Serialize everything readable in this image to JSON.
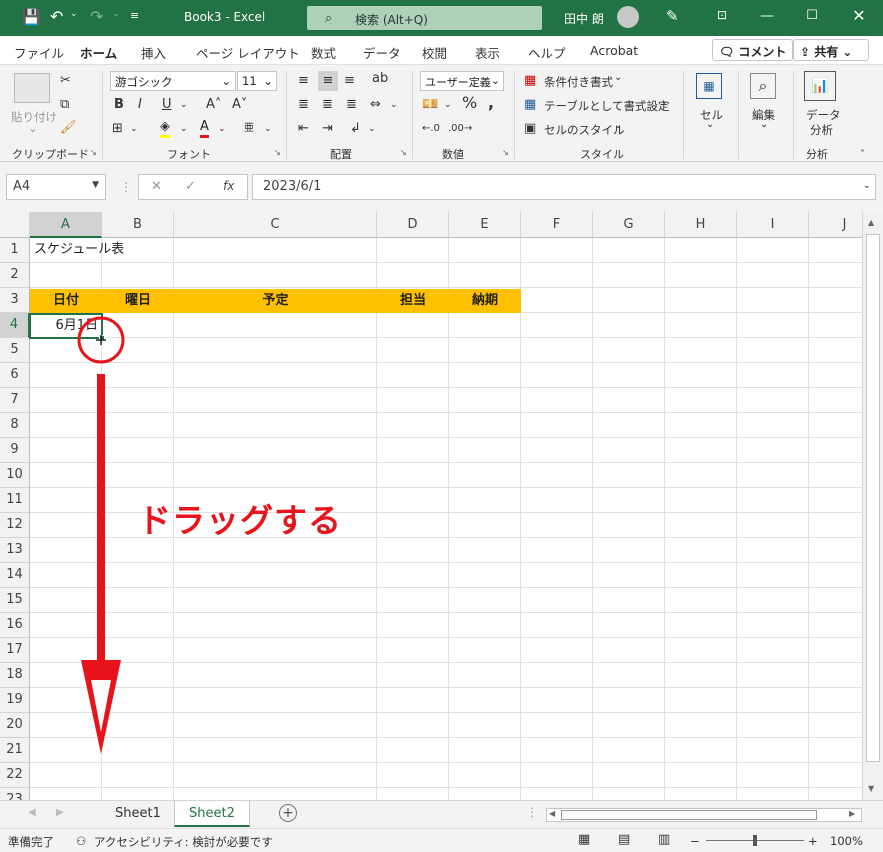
{
  "titlebar": {
    "document_title": "Book3  -  Excel",
    "search_placeholder": "検索 (Alt+Q)",
    "user_name": "田中 朗",
    "colors": {
      "brand": "#217346"
    }
  },
  "menu": {
    "tabs": [
      "ファイル",
      "ホーム",
      "挿入",
      "ページ レイアウト",
      "数式",
      "データ",
      "校閲",
      "表示",
      "ヘルプ",
      "Acrobat"
    ],
    "active_tab": "ホーム",
    "comment_button": "コメント",
    "share_button": "共有"
  },
  "ribbon": {
    "clipboard": {
      "paste_label": "貼り付け",
      "group_label": "クリップボード"
    },
    "font": {
      "font_name": "游ゴシック",
      "font_size": "11",
      "group_label": "フォント"
    },
    "alignment": {
      "group_label": "配置"
    },
    "number": {
      "format": "ユーザー定義",
      "group_label": "数値"
    },
    "styles": {
      "conditional": "条件付き書式",
      "as_table": "テーブルとして書式設定",
      "cell_styles": "セルのスタイル",
      "group_label": "スタイル"
    },
    "cells": {
      "label": "セル"
    },
    "editing": {
      "label": "編集"
    },
    "analysis": {
      "label_line1": "データ",
      "label_line2": "分析",
      "group_label": "分析"
    }
  },
  "formula_bar": {
    "name_box": "A4",
    "fx": "fx",
    "formula": "2023/6/1"
  },
  "sheet": {
    "columns": [
      "A",
      "B",
      "C",
      "D",
      "E",
      "F",
      "G",
      "H",
      "I",
      "J"
    ],
    "rows": [
      "1",
      "2",
      "3",
      "4",
      "5",
      "6",
      "7",
      "8",
      "9",
      "10",
      "11",
      "12",
      "13",
      "14",
      "15",
      "16",
      "17",
      "18",
      "19",
      "20",
      "21",
      "22",
      "23"
    ],
    "selected_cell": "A4",
    "cells": {
      "A1": "スケジュール表",
      "A3": "日付",
      "B3": "曜日",
      "C3": "予定",
      "D3": "担当",
      "E3": "納期",
      "A4": "6月1日"
    },
    "header_fill": "#ffc000"
  },
  "annotation": {
    "text": "ドラッグする",
    "color": "#e8141c"
  },
  "sheet_tabs": {
    "tabs": [
      "Sheet1",
      "Sheet2"
    ],
    "active": "Sheet2"
  },
  "status": {
    "ready": "準備完了",
    "accessibility": "アクセシビリティ: 検討が必要です",
    "zoom": "100%"
  }
}
